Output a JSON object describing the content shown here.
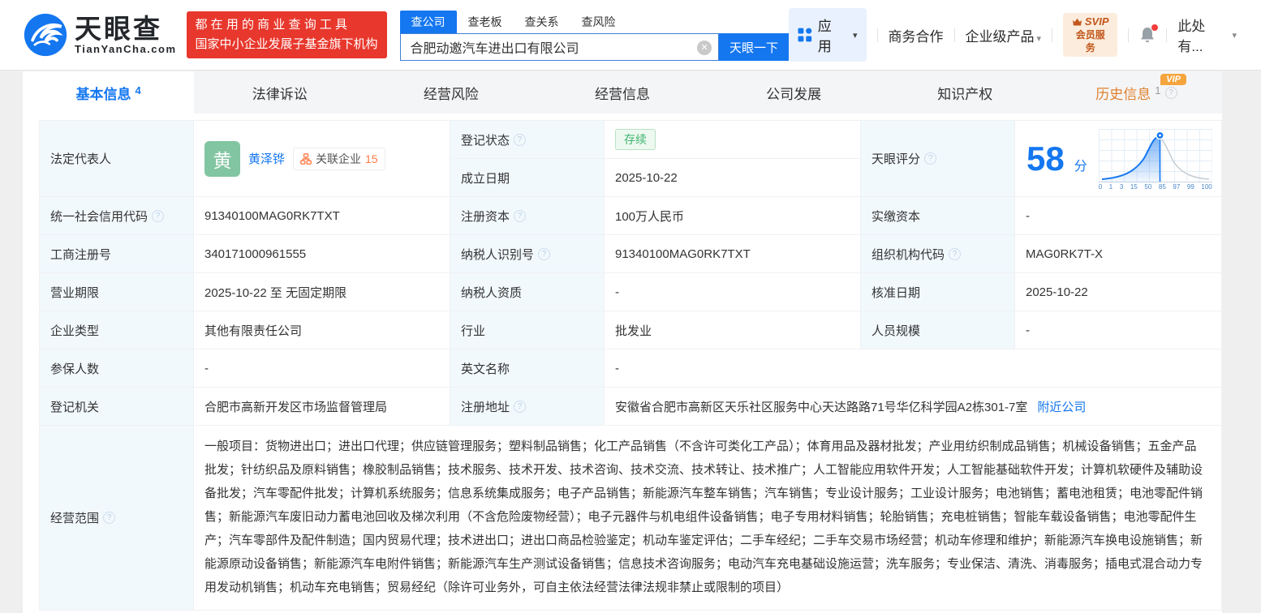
{
  "brand": {
    "name": "天眼查",
    "domain": "TianYanCha.com",
    "slogan_line1": "都 在 用 的 商 业 查 询 工 具",
    "slogan_line2": "国家中小企业发展子基金旗下机构"
  },
  "search": {
    "tabs": [
      {
        "label": "查公司"
      },
      {
        "label": "查老板"
      },
      {
        "label": "查关系"
      },
      {
        "label": "查风险"
      }
    ],
    "value": "合肥动邀汽车进出口有限公司",
    "button_label": "天眼一下"
  },
  "topnav": {
    "apps_label": "应用",
    "biz_label": "商务合作",
    "enterprise_label": "企业级产品",
    "svip_line1": "SVIP",
    "svip_line2": "会员服务",
    "user_label": "此处有..."
  },
  "tabs": [
    {
      "label": "基本信息",
      "count": "4"
    },
    {
      "label": "法律诉讼"
    },
    {
      "label": "经营风险"
    },
    {
      "label": "经营信息"
    },
    {
      "label": "公司发展"
    },
    {
      "label": "知识产权"
    },
    {
      "label": "历史信息",
      "count": "1",
      "vip_badge": "VIP"
    }
  ],
  "row1": {
    "legal_rep_label": "法定代表人",
    "avatar_text": "黄",
    "name": "黄泽铧",
    "related_label": "关联企业",
    "related_count": "15",
    "reg_status_label": "登记状态",
    "reg_status_value": "存续",
    "establish_label": "成立日期",
    "establish_value": "2025-10-22",
    "score_label": "天眼评分",
    "score_value": "58",
    "score_unit": "分"
  },
  "fields": [
    {
      "l1": "统一社会信用代码",
      "v1": "91340100MAG0RK7TXT",
      "l2": "注册资本",
      "v2": "100万人民币",
      "l3": "实缴资本",
      "v3": "-"
    },
    {
      "l1": "工商注册号",
      "v1": "340171000961555",
      "l2": "纳税人识别号",
      "v2": "91340100MAG0RK7TXT",
      "l3": "组织机构代码",
      "v3": "MAG0RK7T-X"
    },
    {
      "l1": "营业期限",
      "v1": "2025-10-22 至 无固定期限",
      "l2": "纳税人资质",
      "v2": "-",
      "l3": "核准日期",
      "v3": "2025-10-22"
    },
    {
      "l1": "企业类型",
      "v1": "其他有限责任公司",
      "l2": "行业",
      "v2": "批发业",
      "l3": "人员规模",
      "v3": "-"
    },
    {
      "l1": "参保人数",
      "v1": "-",
      "l2": "英文名称",
      "v2": "-"
    }
  ],
  "registry": {
    "label": "登记机关",
    "value": "合肥市高新开发区市场监督管理局",
    "addr_label": "注册地址",
    "addr_value": "安徽省合肥市高新区天乐社区服务中心天达路路71号华亿科学园A2栋301-7室",
    "addr_link": "附近公司"
  },
  "scope": {
    "label": "经营范围",
    "text": "一般项目：货物进出口；进出口代理；供应链管理服务；塑料制品销售；化工产品销售（不含许可类化工产品）；体育用品及器材批发；产业用纺织制成品销售；机械设备销售；五金产品批发；针纺织品及原料销售；橡胶制品销售；技术服务、技术开发、技术咨询、技术交流、技术转让、技术推广；人工智能应用软件开发；人工智能基础软件开发；计算机软硬件及辅助设备批发；汽车零配件批发；计算机系统服务；信息系统集成服务；电子产品销售；新能源汽车整车销售；汽车销售；专业设计服务；工业设计服务；电池销售；蓄电池租赁；电池零配件销售；新能源汽车废旧动力蓄电池回收及梯次利用（不含危险废物经营）；电子元器件与机电组件设备销售；电子专用材料销售；轮胎销售；充电桩销售；智能车载设备销售；电池零配件生产；汽车零部件及配件制造；国内贸易代理；技术进出口；进出口商品检验鉴定；机动车鉴定评估；二手车经纪；二手车交易市场经营；机动车修理和维护；新能源汽车换电设施销售；新能源原动设备销售；新能源汽车电附件销售；新能源汽车生产测试设备销售；信息技术咨询服务；电动汽车充电基础设施运营；洗车服务；专业保洁、清洗、消毒服务；插电式混合动力专用发动机销售；机动车充电销售；贸易经纪（除许可业务外，可自主依法经营法律法规非禁止或限制的项目）"
  },
  "chart_data": {
    "type": "area",
    "title": "天眼评分",
    "score": 58,
    "x_ticks": [
      "0",
      "1",
      "3",
      "15",
      "50",
      "85",
      "97",
      "99",
      "100"
    ],
    "note": "bell-curve score distribution, blue fill up to score 58 with pin marker"
  },
  "colors": {
    "accent": "#1477f0",
    "status_green": "#3eb370",
    "label_cell_bg": "#f2f9fd",
    "history_orange": "#e0812e",
    "vip_orange": "#f5a53d",
    "banner_red": "#e8372c",
    "svip_text": "#c2571b"
  },
  "icons": {
    "help": "?",
    "caret": "▾",
    "clear": "✕"
  }
}
